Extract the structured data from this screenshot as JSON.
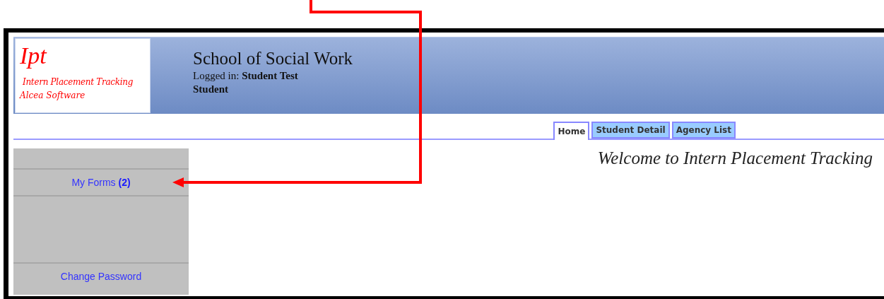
{
  "logo": {
    "mark": "Ipt",
    "product": "Intern Placement Tracking",
    "vendor": "Alcea Software"
  },
  "header": {
    "title": "School of Social Work",
    "login_label": "Logged in:",
    "user": "Student Test Student"
  },
  "tabs": [
    {
      "label": "Home",
      "selected": true
    },
    {
      "label": "Student Detail",
      "selected": false
    },
    {
      "label": "Agency List",
      "selected": false
    }
  ],
  "sidebar": {
    "items": [
      {
        "kind": "spacer"
      },
      {
        "kind": "link",
        "label": "My Forms **(2)**"
      },
      {
        "kind": "tall-spacer"
      },
      {
        "kind": "link",
        "label": "Change Password"
      }
    ]
  },
  "content": {
    "welcome": "Welcome to Intern Placement Tracking"
  }
}
